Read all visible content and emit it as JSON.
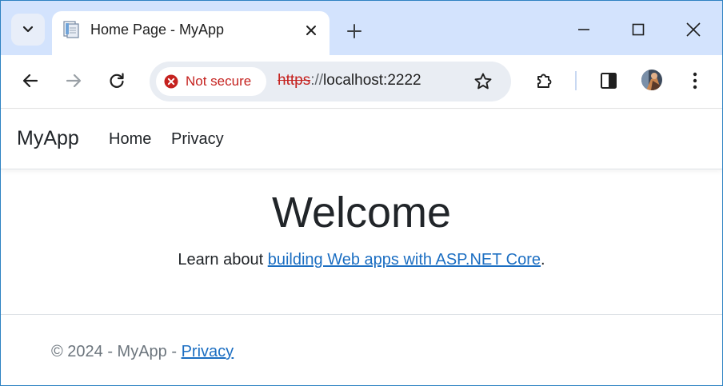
{
  "browser": {
    "tab": {
      "title": "Home Page - MyApp"
    },
    "address_bar": {
      "security_label": "Not secure",
      "url_scheme": "https",
      "url_separator": "://",
      "url_host": "localhost:2222"
    },
    "icons": {
      "tab_search": "chevron-down-icon",
      "favicon": "page-favicon-icon",
      "tab_close": "close-icon",
      "new_tab": "plus-icon",
      "minimize": "minimize-icon",
      "maximize": "maximize-icon",
      "close_window": "close-icon",
      "back": "back-arrow-icon",
      "forward": "forward-arrow-icon",
      "reload": "reload-icon",
      "security": "error-circle-icon",
      "bookmark": "star-icon",
      "extensions": "puzzle-icon",
      "side_panel": "side-panel-icon",
      "profile": "avatar",
      "menu": "more-vertical-icon"
    },
    "colors": {
      "titlebar_bg": "#d3e3fd",
      "omnibox_bg": "#e9edf3",
      "not_secure_red": "#c5221f",
      "link_blue": "#1b6ec2"
    }
  },
  "site": {
    "navbar": {
      "brand": "MyApp",
      "links": [
        "Home",
        "Privacy"
      ]
    },
    "hero": {
      "title": "Welcome",
      "text_before_link": "Learn about ",
      "link_text": "building Web apps with ASP.NET Core",
      "text_after_link": "."
    },
    "footer": {
      "text": "© 2024 - MyApp - ",
      "link_text": "Privacy"
    }
  }
}
